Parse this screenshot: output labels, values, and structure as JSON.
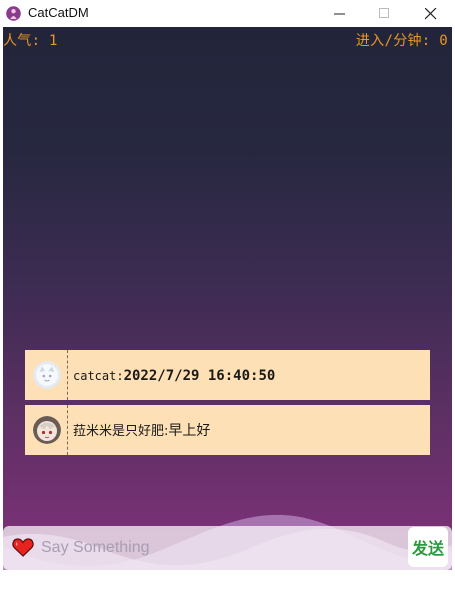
{
  "window": {
    "title": "CatCatDM",
    "controls": [
      "minimize-icon",
      "maximize-icon",
      "close-icon"
    ]
  },
  "stats": {
    "popularity": "人气: 1",
    "entries_per_minute": "进入/分钟: 0"
  },
  "danmaku": [
    {
      "user": "catcat:",
      "message": "2022/7/29 16:40:50",
      "avatar": "avatar-default"
    },
    {
      "user": "菈米米是只好肥:",
      "message": "早上好",
      "avatar": "avatar-anime"
    }
  ],
  "input": {
    "placeholder": "Say Something",
    "value": "",
    "send_label": "发送",
    "heart_icon": "heart-icon"
  },
  "colors": {
    "stat_text": "#ee9520",
    "bubble": "#fde0b5",
    "send_text": "#2b9a3f",
    "heart": "#e8231f"
  }
}
